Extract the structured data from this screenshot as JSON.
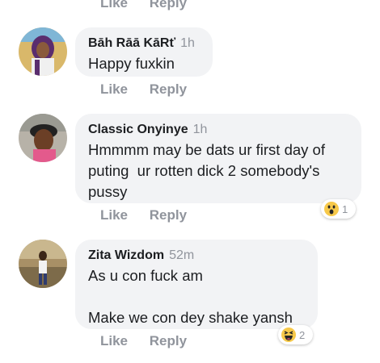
{
  "top_actions": {
    "like": "Like",
    "reply": "Reply"
  },
  "comments": [
    {
      "author": "Bāh Rāā KāRť",
      "time": "1h",
      "text": "Happy fuxkin",
      "like": "Like",
      "reply": "Reply"
    },
    {
      "author": "Classic Onyinye",
      "time": "1h",
      "text": "Hmmmm may be dats ur first day of puting  ur rotten dick 2 somebody's pussy",
      "like": "Like",
      "reply": "Reply",
      "reaction": {
        "icon": "wow-icon",
        "count": "1"
      }
    },
    {
      "author": "Zita Wizdom",
      "time": "52m",
      "text": "As u con fuck am\n\nMake we con dey shake yansh",
      "like": "Like",
      "reply": "Reply",
      "reaction": {
        "icon": "haha-icon",
        "count": "2"
      }
    }
  ],
  "colors": {
    "bubble": "#f2f3f5",
    "meta": "#90949c",
    "reaction_yellow": "#f7c94a"
  }
}
